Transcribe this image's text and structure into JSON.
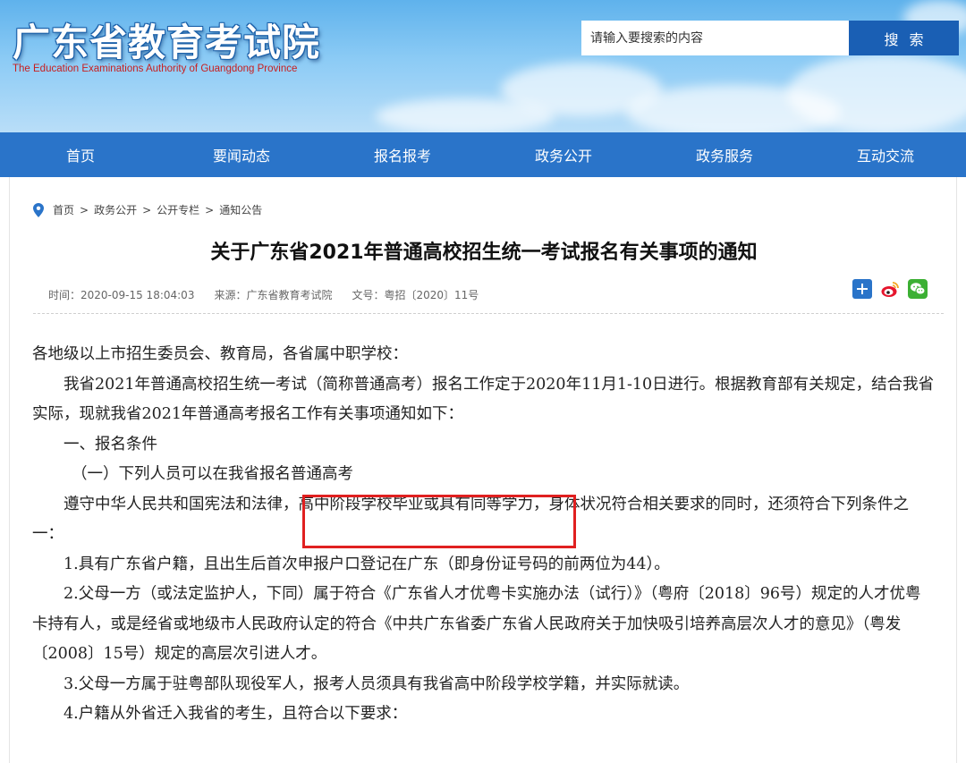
{
  "header": {
    "title": "广东省教育考试院",
    "subtitle": "The Education Examinations Authority of Guangdong Province",
    "search_placeholder": "请输入要搜索的内容",
    "search_button": "搜索"
  },
  "nav": {
    "items": [
      "首页",
      "要闻动态",
      "报名报考",
      "政务公开",
      "政务服务",
      "互动交流"
    ]
  },
  "breadcrumb": [
    "首页",
    "政务公开",
    "公开专栏",
    "通知公告"
  ],
  "breadcrumb_sep": ">",
  "article": {
    "title": "关于广东省2021年普通高校招生统一考试报名有关事项的通知",
    "time": "时间：2020-09-15 18:04:03",
    "source": "来源：广东省教育考试院",
    "doc_no": "文号：粤招〔2020〕11号",
    "paragraphs": {
      "p1": "各地级以上市招生委员会、教育局，各省属中职学校：",
      "p2": "我省2021年普通高校招生统一考试（简称普通高考）报名工作定于2020年11月1-10日进行。根据教育部有关规定，结合我省实际，现就我省2021年普通高考报名工作有关事项通知如下：",
      "p3": "一、报名条件",
      "p4": "（一）下列人员可以在我省报名普通高考",
      "p5a": "遵守中华人民共和国宪法和法律，",
      "p5b": "高中阶段学校毕业或具有同等学力",
      "p5c": "，身体状况符合相关要求的同时，还须符合下列条件之一：",
      "p6": "1.具有广东省户籍，且出生后首次申报户口登记在广东（即身份证号码的前两位为44）。",
      "p7": "2.父母一方（或法定监护人，下同）属于符合《广东省人才优粤卡实施办法（试行）》（粤府〔2018〕96号）规定的人才优粤卡持有人，或是经省或地级市人民政府认定的符合《中共广东省委广东省人民政府关于加快吸引培养高层次人才的意见》（粤发〔2008〕15号）规定的高层次引进人才。",
      "p8": "3.父母一方属于驻粤部队现役军人，报考人员须具有我省高中阶段学校学籍，并实际就读。",
      "p9": "4.户籍从外省迁入我省的考生，且符合以下要求："
    }
  },
  "share": [
    "plus-icon",
    "weibo-icon",
    "wechat-icon"
  ],
  "colors": {
    "nav": "#2a74c9",
    "search_button": "#1a5fb4",
    "highlight": "#e02020",
    "subtitle": "#c81e1e"
  }
}
